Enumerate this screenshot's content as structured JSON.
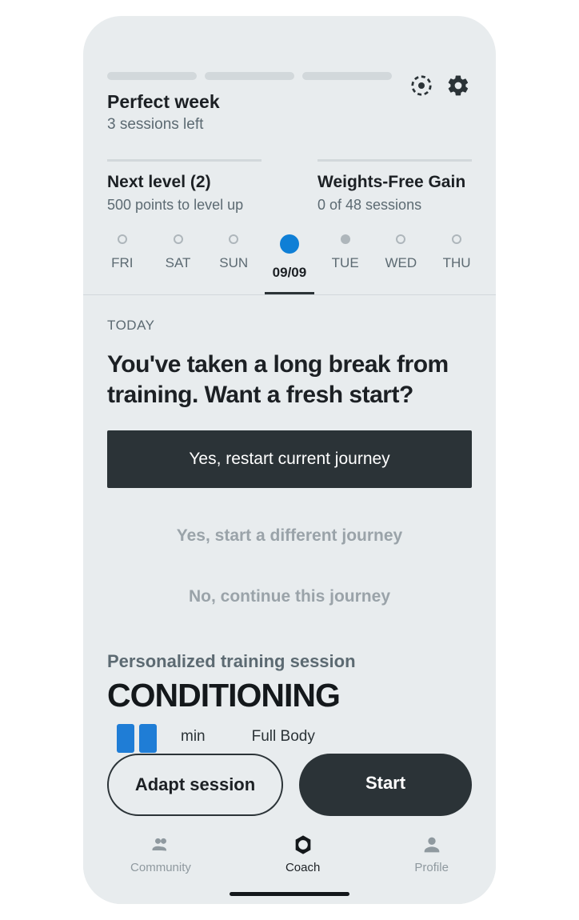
{
  "header": {
    "perfect_week_title": "Perfect week",
    "sessions_left": "3 sessions left"
  },
  "progress": {
    "level_title": "Next level (2)",
    "level_sub": "500 points to level up",
    "journey_title": "Weights-Free Gain",
    "journey_sub": "0 of 48 sessions"
  },
  "days": [
    {
      "label": "FRI",
      "state": "ring"
    },
    {
      "label": "SAT",
      "state": "ring"
    },
    {
      "label": "SUN",
      "state": "ring"
    },
    {
      "label": "09/09",
      "state": "active"
    },
    {
      "label": "TUE",
      "state": "muted"
    },
    {
      "label": "WED",
      "state": "ring"
    },
    {
      "label": "THU",
      "state": "ring"
    }
  ],
  "today": {
    "eyebrow": "TODAY",
    "heading": "You've taken a long break from training. Want a fresh start?",
    "cta_primary": "Yes, restart current journey",
    "cta_secondary": "Yes, start a different journey",
    "cta_tertiary": "No, continue this journey"
  },
  "session": {
    "label": "Personalized training session",
    "name": "CONDITIONING",
    "duration": "min",
    "focus": "Full Body"
  },
  "float": {
    "adapt": "Adapt session",
    "start": "Start"
  },
  "tabs": {
    "community": "Community",
    "coach": "Coach",
    "profile": "Profile"
  }
}
